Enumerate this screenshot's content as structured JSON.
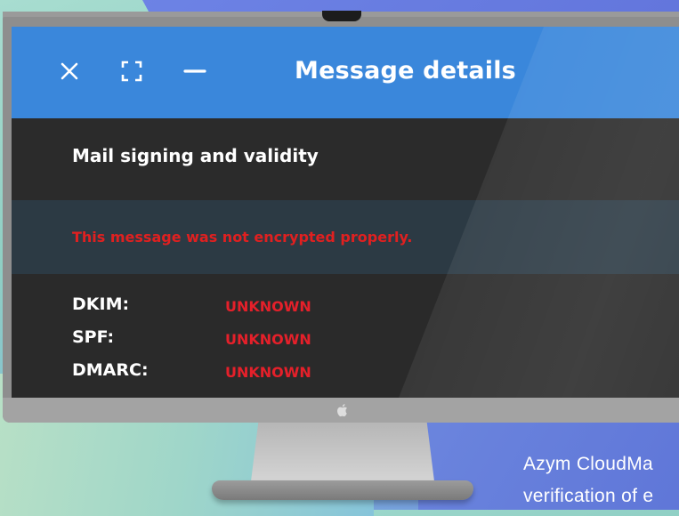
{
  "window": {
    "title": "Message details",
    "controls": [
      "close-icon",
      "fullscreen-icon",
      "minimize-icon"
    ]
  },
  "section": {
    "title": "Mail signing and validity",
    "warning": "This message was not encrypted properly."
  },
  "checks": [
    {
      "label": "DKIM:",
      "value": "UNKNOWN"
    },
    {
      "label": "SPF:",
      "value": "UNKNOWN"
    },
    {
      "label": "DMARC:",
      "value": "UNKNOWN"
    }
  ],
  "caption": {
    "line1": "Azym CloudMa",
    "line2": "verification of e"
  },
  "colors": {
    "header": "#3a87db",
    "warning": "#e02020",
    "panel": "#2a2a2a"
  }
}
